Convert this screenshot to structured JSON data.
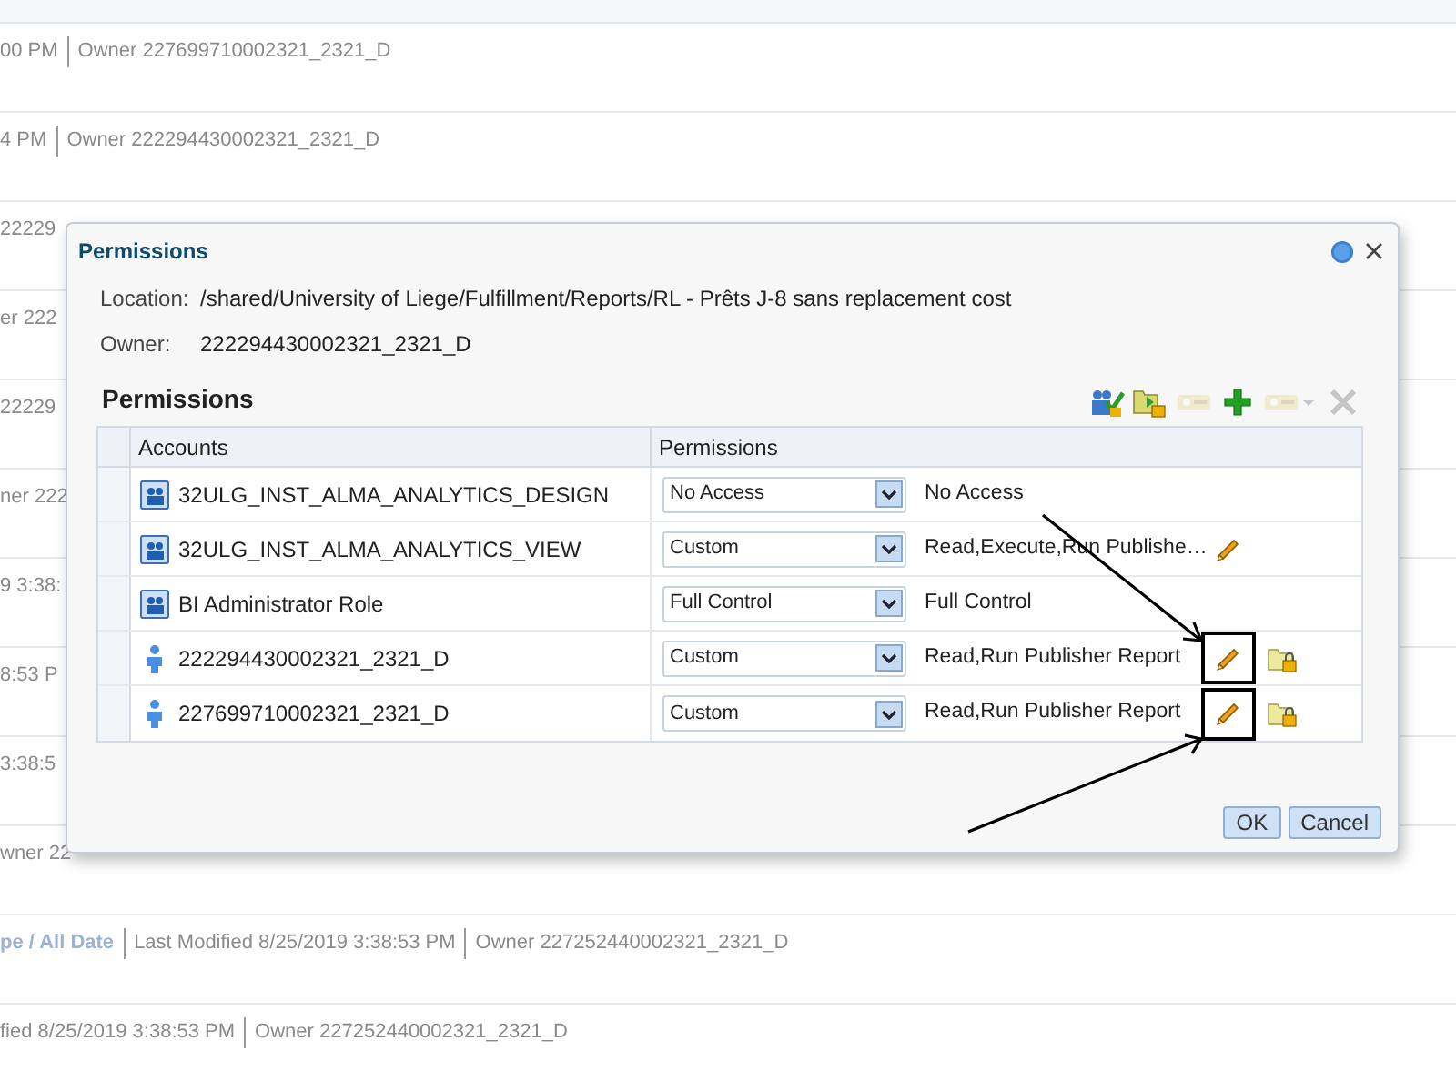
{
  "background_rows": [
    {
      "segments": [
        {
          "kind": "text",
          "text": "00 PM"
        },
        {
          "kind": "text",
          "text": "Owner 227699710002321_2321_D"
        }
      ]
    },
    {
      "segments": [
        {
          "kind": "text",
          "text": "4 PM"
        },
        {
          "kind": "text",
          "text": "Owner 222294430002321_2321_D"
        }
      ]
    },
    {
      "segments": [
        {
          "kind": "text",
          "text": "22229"
        }
      ]
    },
    {
      "segments": [
        {
          "kind": "text",
          "text": "er 222"
        }
      ]
    },
    {
      "segments": [
        {
          "kind": "text",
          "text": "22229"
        }
      ]
    },
    {
      "segments": [
        {
          "kind": "text",
          "text": "ner 222"
        }
      ]
    },
    {
      "segments": [
        {
          "kind": "text",
          "text": "9 3:38:"
        }
      ]
    },
    {
      "segments": [
        {
          "kind": "text",
          "text": "8:53 P"
        }
      ]
    },
    {
      "segments": [
        {
          "kind": "text",
          "text": "3:38:5"
        }
      ]
    },
    {
      "segments": [
        {
          "kind": "text",
          "text": "wner 22"
        }
      ]
    },
    {
      "segments": [
        {
          "kind": "link",
          "text": "pe / All Date"
        },
        {
          "kind": "text",
          "text": "Last Modified 8/25/2019 3:38:53 PM"
        },
        {
          "kind": "text",
          "text": "Owner 227252440002321_2321_D"
        }
      ]
    },
    {
      "segments": [
        {
          "kind": "text",
          "text": "fied 8/25/2019 3:38:53 PM"
        },
        {
          "kind": "text",
          "text": "Owner 227252440002321_2321_D"
        }
      ]
    }
  ],
  "dialog": {
    "title": "Permissions",
    "fields": [
      {
        "label": "Location:",
        "value": "/shared/University of Liege/Fulfillment/Reports/RL - Prêts J-8 sans replacement cost"
      },
      {
        "label": "Owner:",
        "value": "222294430002321_2321_D"
      }
    ],
    "section_title": "Permissions",
    "toolbar": [
      {
        "kind": "users-check",
        "disabled": false
      },
      {
        "kind": "folder-lock",
        "disabled": false
      },
      {
        "kind": "key",
        "disabled": true
      },
      {
        "kind": "add",
        "disabled": false
      },
      {
        "kind": "key-menu",
        "disabled": true
      },
      {
        "kind": "delete",
        "disabled": true
      }
    ],
    "table": {
      "columns": [
        "Accounts",
        "Permissions"
      ],
      "rows": [
        {
          "kind": "group",
          "account": "32ULG_INST_ALMA_ANALYTICS_DESIGN",
          "permission": "No Access",
          "detail": "No Access",
          "edit": false,
          "folder_lock": false,
          "highlighted": false
        },
        {
          "kind": "group",
          "account": "32ULG_INST_ALMA_ANALYTICS_VIEW",
          "permission": "Custom",
          "detail": "Read,Execute,Run Publishe…",
          "edit": true,
          "folder_lock": false,
          "highlighted": false
        },
        {
          "kind": "group",
          "account": "BI Administrator Role",
          "permission": "Full Control",
          "detail": "Full Control",
          "edit": false,
          "folder_lock": false,
          "highlighted": false
        },
        {
          "kind": "user",
          "account": "222294430002321_2321_D",
          "permission": "Custom",
          "detail": "Read,Run Publisher Report",
          "edit": true,
          "folder_lock": true,
          "highlighted": true
        },
        {
          "kind": "user",
          "account": "227699710002321_2321_D",
          "permission": "Custom",
          "detail": "Read,Run Publisher Report",
          "edit": true,
          "folder_lock": true,
          "highlighted": true
        }
      ]
    },
    "buttons": [
      "OK",
      "Cancel"
    ]
  }
}
